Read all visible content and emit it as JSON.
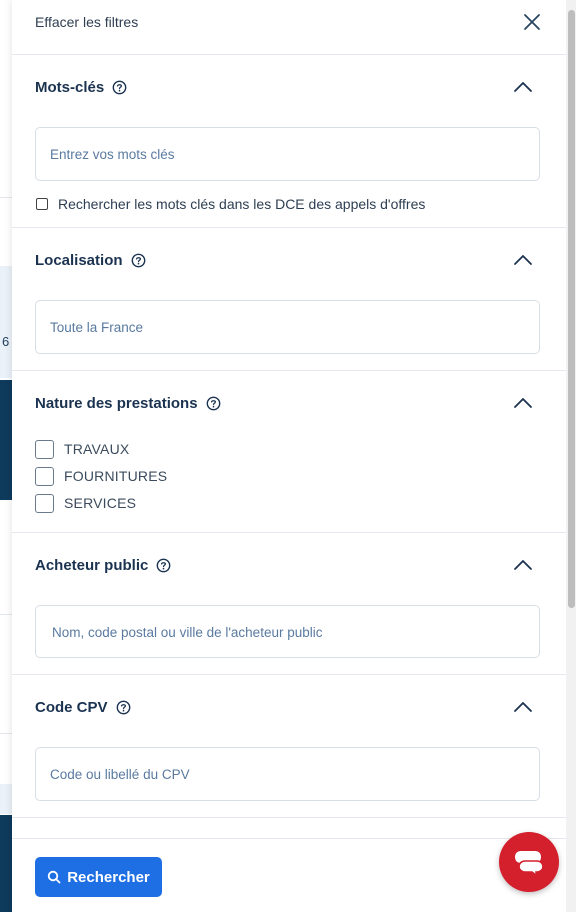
{
  "background": {
    "digit": "6"
  },
  "panel": {
    "clear_filters": "Effacer les filtres",
    "close_icon": "close-icon"
  },
  "sections": {
    "keywords": {
      "title": "Mots-clés",
      "placeholder": "Entrez vos mots clés",
      "checkbox_label": "Rechercher les mots clés dans les DCE des appels d'offres"
    },
    "location": {
      "title": "Localisation",
      "placeholder": "Toute la France"
    },
    "nature": {
      "title": "Nature des prestations",
      "options": [
        "TRAVAUX",
        "FOURNITURES",
        "SERVICES"
      ]
    },
    "buyer": {
      "title": "Acheteur public",
      "placeholder": "Nom, code postal ou ville de l'acheteur public"
    },
    "cpv": {
      "title": "Code CPV",
      "placeholder": "Code ou libellé du CPV"
    }
  },
  "footer": {
    "search_label": "Rechercher"
  },
  "colors": {
    "primary": "#1e6fe3",
    "chat": "#d41f2c",
    "title": "#1b3350"
  }
}
